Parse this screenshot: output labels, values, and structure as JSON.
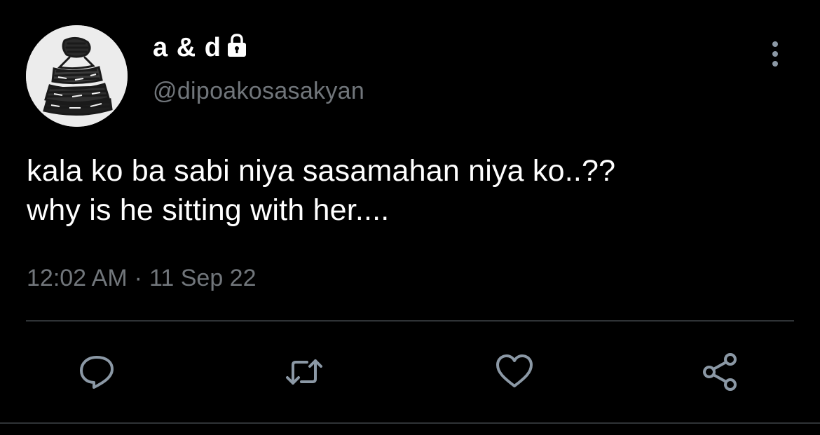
{
  "author": {
    "display_name": "a & d",
    "handle": "@dipoakosasakyan",
    "protected_icon": "lock-icon",
    "avatar_icon": "avatar-image"
  },
  "tweet": {
    "text_lines": [
      "kala ko ba sabi niya sasamahan niya ko..??",
      "why is he sitting with her...."
    ],
    "time": "12:02 AM",
    "separator": "·",
    "date": "11 Sep 22"
  },
  "actions": {
    "more_icon": "more-vertical-icon",
    "reply_icon": "reply-icon",
    "retweet_icon": "retweet-icon",
    "like_icon": "heart-icon",
    "share_icon": "share-icon"
  },
  "colors": {
    "background": "#000000",
    "primary_text": "#ffffff",
    "secondary_text": "#71767b",
    "divider": "#2f3336",
    "action_icon": "#8b98a5"
  }
}
